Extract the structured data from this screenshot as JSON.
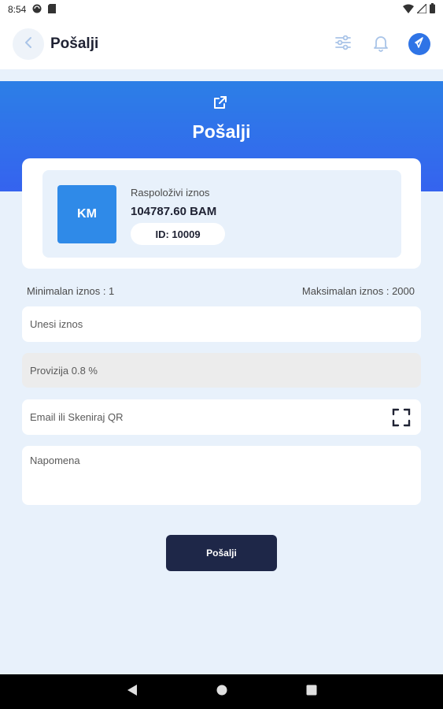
{
  "status_bar": {
    "time": "8:54"
  },
  "app_bar": {
    "title": "Pošalji"
  },
  "hero": {
    "title": "Pošalji"
  },
  "balance_card": {
    "currency_code": "KM",
    "label": "Raspoloživi iznos",
    "amount": "104787.60 BAM",
    "id_text": "ID: 10009"
  },
  "limits": {
    "min": "Minimalan iznos : 1",
    "max": "Maksimalan iznos : 2000"
  },
  "form": {
    "amount_placeholder": "Unesi iznos",
    "fee_text": "Provizija 0.8 %",
    "recipient_placeholder": "Email ili Skeniraj QR",
    "note_placeholder": "Napomena",
    "submit_label": "Pošalji"
  },
  "colors": {
    "accent": "#2f74e6",
    "hero_gradient_top": "#2c7fe6",
    "hero_gradient_bottom": "#3563ef",
    "submit_bg": "#1e2748",
    "page_bg": "#e8f1fb"
  },
  "icons": {
    "back": "chevron-left-icon",
    "filter": "sliders-icon",
    "notifications": "bell-icon",
    "profile": "paper-plane-icon",
    "hero": "external-link-icon",
    "qr": "qr-scan-icon"
  }
}
